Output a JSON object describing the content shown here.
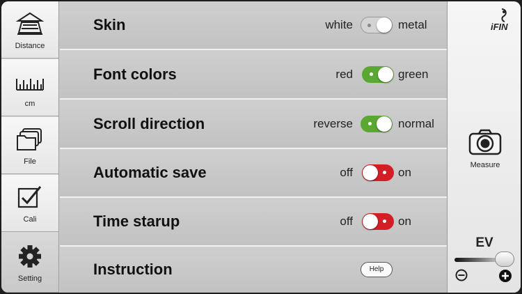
{
  "sidebar": {
    "items": [
      {
        "label": "Distance",
        "icon": "distance-icon"
      },
      {
        "label": "cm",
        "icon": "ruler-icon"
      },
      {
        "label": "File",
        "icon": "folder-icon"
      },
      {
        "label": "Cali",
        "icon": "calibration-icon"
      },
      {
        "label": "Setting",
        "icon": "gear-icon",
        "active": true
      }
    ]
  },
  "settings": {
    "skin": {
      "title": "Skin",
      "off_label": "white",
      "on_label": "metal",
      "state": "white"
    },
    "font_colors": {
      "title": "Font colors",
      "off_label": "red",
      "on_label": "green",
      "state": "green"
    },
    "scroll_direction": {
      "title": "Scroll direction",
      "off_label": "reverse",
      "on_label": "normal",
      "state": "normal"
    },
    "automatic_save": {
      "title": "Automatic save",
      "off_label": "off",
      "on_label": "on",
      "state": "off"
    },
    "time_startup": {
      "title": "Time starup",
      "off_label": "off",
      "on_label": "on",
      "state": "off"
    },
    "instruction": {
      "title": "Instruction",
      "button_label": "Help"
    }
  },
  "rightpanel": {
    "logo_text": "iFIN",
    "measure_label": "Measure",
    "ev_label": "EV",
    "ev_level": 0.85
  },
  "colors": {
    "toggle_green": "#5aa832",
    "toggle_red": "#d21e24",
    "toggle_gray": "#cfcfcf"
  }
}
